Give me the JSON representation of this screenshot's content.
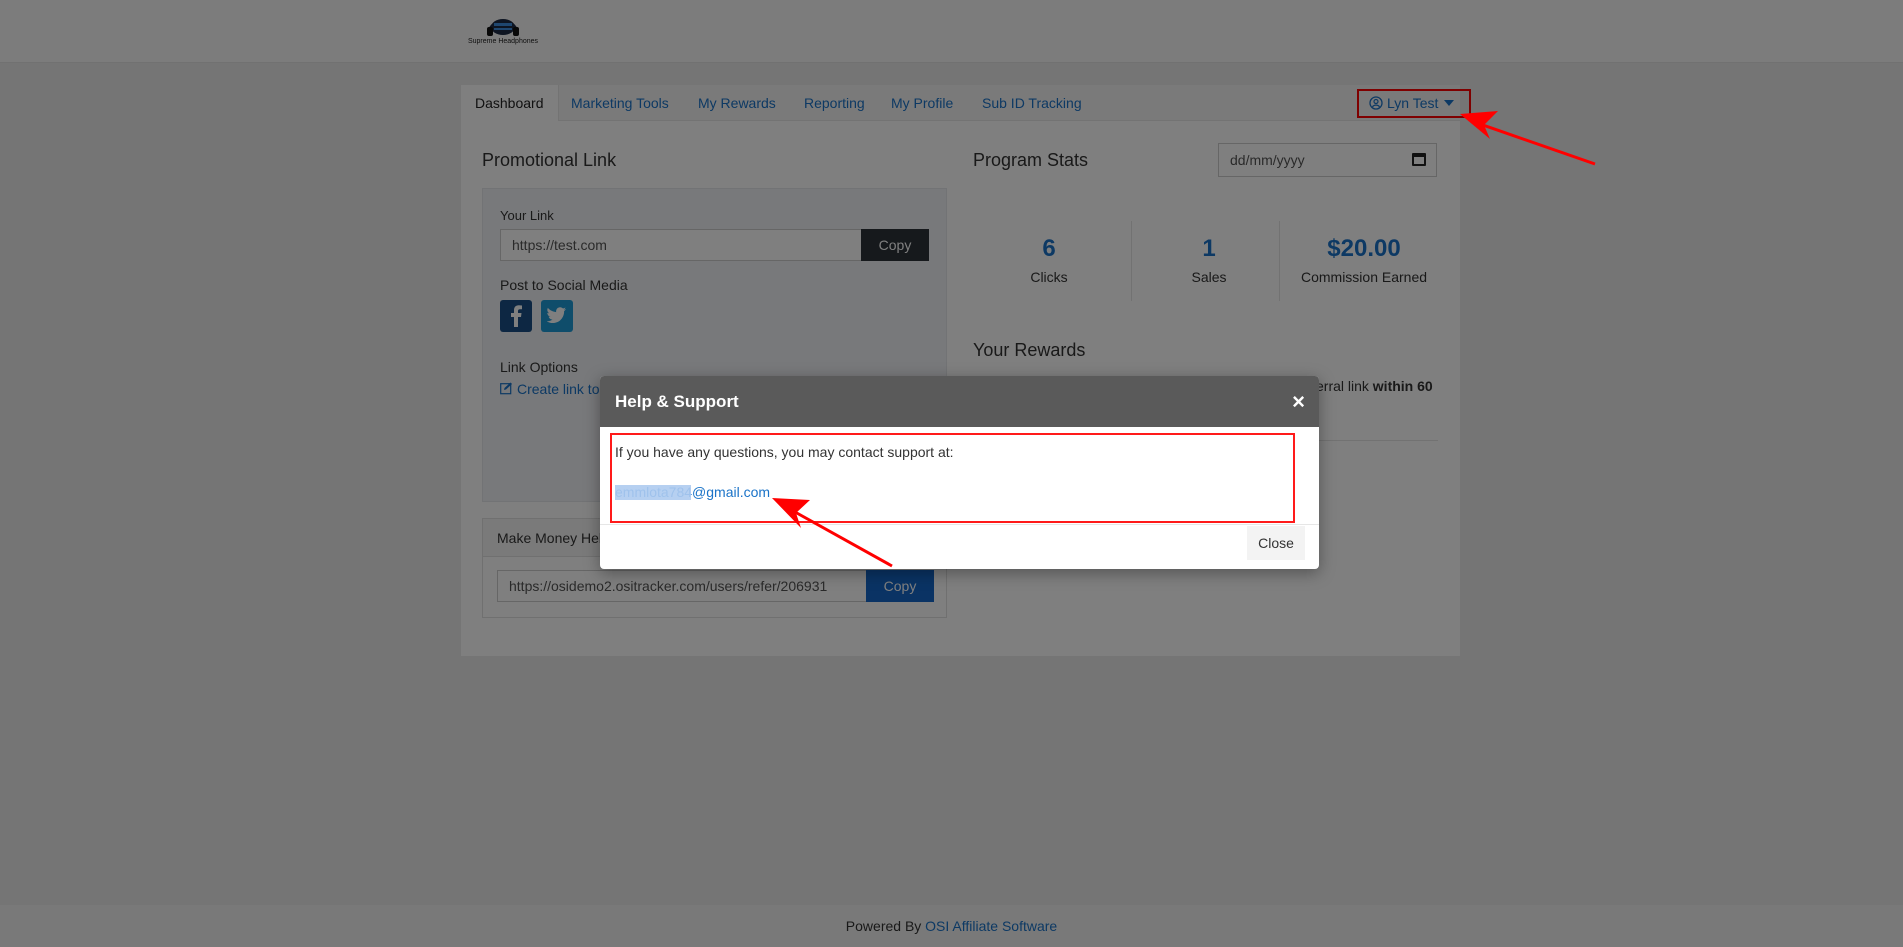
{
  "brand": {
    "logo_text": "Supreme Headphones"
  },
  "nav": {
    "tabs": [
      {
        "label": "Dashboard"
      },
      {
        "label": "Marketing Tools"
      },
      {
        "label": "My Rewards"
      },
      {
        "label": "Reporting"
      },
      {
        "label": "My Profile"
      },
      {
        "label": "Sub ID Tracking"
      }
    ],
    "user_label": "Lyn Test"
  },
  "promo": {
    "title": "Promotional Link",
    "your_link_label": "Your Link",
    "link_value": "https://test.com",
    "copy_label": "Copy",
    "social_label": "Post to Social Media",
    "options_label": "Link Options",
    "create_link": "Create link to"
  },
  "money": {
    "header": "Make Money Help",
    "link_value": "https://osidemo2.ositracker.com/users/refer/206931",
    "copy_label": "Copy"
  },
  "stats": {
    "title": "Program Stats",
    "date_placeholder": "dd/mm/yyyy",
    "items": [
      {
        "value": "6",
        "label": "Clicks"
      },
      {
        "value": "1",
        "label": "Sales"
      },
      {
        "value": "$20.00",
        "label": "Commission Earned"
      }
    ]
  },
  "rewards": {
    "title": "Your Rewards",
    "partial_text": "erral link",
    "bold_text": "within 60"
  },
  "modal": {
    "title": "Help & Support",
    "close_x": "×",
    "message": "If you have any questions, you may contact support at:",
    "email": "emmlota784@gmail.com",
    "close_label": "Close"
  },
  "footer": {
    "prefix": "Powered By",
    "link": "OSI Affiliate Software"
  },
  "colors": {
    "link_blue": "#1a73c8",
    "annotation_red": "#ff0000",
    "modal_header": "#5a5a5a"
  }
}
